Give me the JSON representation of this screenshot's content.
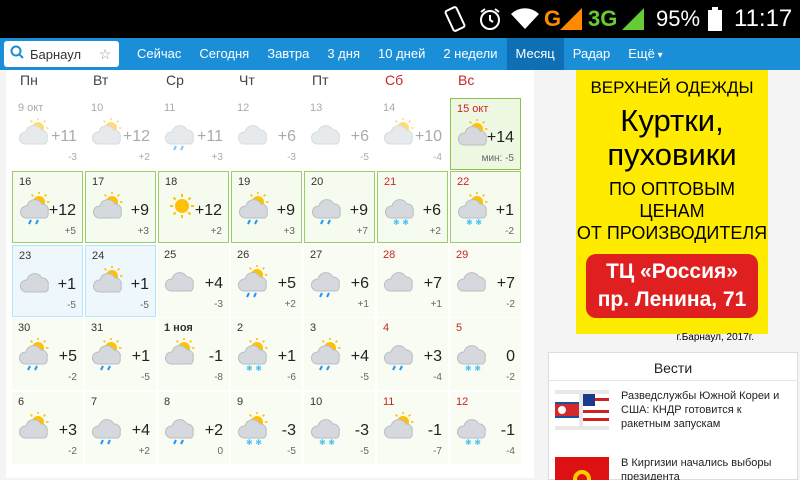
{
  "status_bar": {
    "network": "G",
    "network2": "3G",
    "battery": "95%",
    "time": "11:17",
    "icons": [
      "rotate-lock-icon",
      "alarm-icon",
      "wifi-icon",
      "signal-icon",
      "battery-icon"
    ]
  },
  "nav": {
    "search_value": "Барнаул",
    "tabs": [
      "Сейчас",
      "Сегодня",
      "Завтра",
      "3 дня",
      "10 дней",
      "2 недели",
      "Месяц",
      "Радар",
      "Ещё"
    ],
    "active_tab": "Месяц"
  },
  "calendar": {
    "days_of_week": [
      "Пн",
      "Вт",
      "Ср",
      "Чт",
      "Пт",
      "Сб",
      "Вс"
    ],
    "weekend_color": "#c62828",
    "weeks": [
      [
        {
          "date": "9 окт",
          "temp": "+11",
          "min": "-3",
          "icon": "partly-cloudy-icon",
          "past": true
        },
        {
          "date": "10",
          "temp": "+12",
          "min": "+2",
          "icon": "partly-cloudy-icon",
          "past": true
        },
        {
          "date": "11",
          "temp": "+11",
          "min": "+3",
          "icon": "cloud-rain-icon",
          "past": true
        },
        {
          "date": "12",
          "temp": "+6",
          "min": "-3",
          "icon": "cloud-icon",
          "past": true
        },
        {
          "date": "13",
          "temp": "+6",
          "min": "-5",
          "icon": "cloud-icon",
          "past": true
        },
        {
          "date": "14",
          "temp": "+10",
          "min": "-4",
          "icon": "sun-cloud-icon",
          "past": true
        },
        {
          "date": "15 окт",
          "temp": "+14",
          "min": "мин: -5",
          "icon": "sun-cloud-icon",
          "today": true
        }
      ],
      [
        {
          "date": "16",
          "temp": "+12",
          "min": "+5",
          "icon": "sun-cloud-rain-icon"
        },
        {
          "date": "17",
          "temp": "+9",
          "min": "+3",
          "icon": "sun-cloud-icon"
        },
        {
          "date": "18",
          "temp": "+12",
          "min": "+2",
          "icon": "sun-icon"
        },
        {
          "date": "19",
          "temp": "+9",
          "min": "+3",
          "icon": "sun-cloud-rain-icon"
        },
        {
          "date": "20",
          "temp": "+9",
          "min": "+7",
          "icon": "cloud-rain-icon"
        },
        {
          "date": "21",
          "temp": "+6",
          "min": "+2",
          "icon": "cloud-snow-icon"
        },
        {
          "date": "22",
          "temp": "+1",
          "min": "-2",
          "icon": "sun-cloud-snow-icon"
        }
      ],
      [
        {
          "date": "23",
          "temp": "+1",
          "min": "-5",
          "icon": "cloud-icon"
        },
        {
          "date": "24",
          "temp": "+1",
          "min": "-5",
          "icon": "sun-cloud-icon"
        },
        {
          "date": "25",
          "temp": "+4",
          "min": "-3",
          "icon": "cloud-icon"
        },
        {
          "date": "26",
          "temp": "+5",
          "min": "+2",
          "icon": "sun-cloud-rain-icon"
        },
        {
          "date": "27",
          "temp": "+6",
          "min": "+1",
          "icon": "cloud-rain-icon"
        },
        {
          "date": "28",
          "temp": "+7",
          "min": "+1",
          "icon": "cloud-icon"
        },
        {
          "date": "29",
          "temp": "+7",
          "min": "-2",
          "icon": "cloud-icon"
        }
      ],
      [
        {
          "date": "30",
          "temp": "+5",
          "min": "-2",
          "icon": "sun-cloud-rain-icon"
        },
        {
          "date": "31",
          "temp": "+1",
          "min": "-5",
          "icon": "sun-cloud-rain-icon"
        },
        {
          "date": "1 ноя",
          "temp": "-1",
          "min": "-8",
          "icon": "sun-cloud-icon",
          "bold": true
        },
        {
          "date": "2",
          "temp": "+1",
          "min": "-6",
          "icon": "sun-cloud-snow-icon"
        },
        {
          "date": "3",
          "temp": "+4",
          "min": "-5",
          "icon": "sun-cloud-rain-icon"
        },
        {
          "date": "4",
          "temp": "+3",
          "min": "-4",
          "icon": "cloud-rain-icon"
        },
        {
          "date": "5",
          "temp": "0",
          "min": "-2",
          "icon": "cloud-snow-icon"
        }
      ],
      [
        {
          "date": "6",
          "temp": "+3",
          "min": "-2",
          "icon": "sun-cloud-icon"
        },
        {
          "date": "7",
          "temp": "+4",
          "min": "+2",
          "icon": "cloud-rain-icon"
        },
        {
          "date": "8",
          "temp": "+2",
          "min": "0",
          "icon": "cloud-rain-icon"
        },
        {
          "date": "9",
          "temp": "-3",
          "min": "-5",
          "icon": "sun-cloud-snow-icon"
        },
        {
          "date": "10",
          "temp": "-3",
          "min": "-5",
          "icon": "cloud-snow-icon"
        },
        {
          "date": "11",
          "temp": "-1",
          "min": "-7",
          "icon": "sun-cloud-icon"
        },
        {
          "date": "12",
          "temp": "-1",
          "min": "-4",
          "icon": "cloud-snow-icon"
        }
      ]
    ]
  },
  "ad": {
    "line1": "ВЕРХНЕЙ ОДЕЖДЫ",
    "line2": "Куртки,",
    "line3": "пуховики",
    "line4": "ПО ОПТОВЫМ ЦЕНАМ",
    "line5": "ОТ ПРОИЗВОДИТЕЛЯ",
    "box1": "ТЦ «Россия»",
    "box2": "пр. Ленина, 71",
    "footer": "г.Барнаул, 2017г."
  },
  "news": {
    "title": "Вести",
    "items": [
      {
        "text": "Разведслужбы Южной Кореи и США: КНДР готовится к ракетным запускам"
      },
      {
        "text": "В Киргизии начались выборы президента"
      }
    ]
  }
}
